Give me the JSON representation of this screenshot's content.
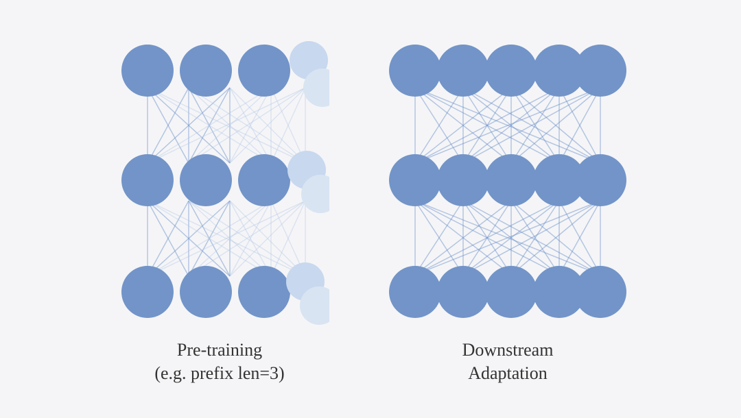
{
  "diagrams": [
    {
      "id": "pre-training",
      "caption_line1": "Pre-training",
      "caption_line2": "(e.g. prefix len=3)",
      "type": "partial"
    },
    {
      "id": "downstream",
      "caption_line1": "Downstream",
      "caption_line2": "Adaptation",
      "type": "full"
    }
  ],
  "colors": {
    "dark_node": "#7294c8",
    "medium_node": "#a8bfe0",
    "light_node": "#ccd8ed",
    "very_light_node": "#dde6f2",
    "edge_dark": "rgba(100, 140, 200, 0.5)",
    "edge_light": "rgba(180, 200, 230, 0.35)"
  }
}
